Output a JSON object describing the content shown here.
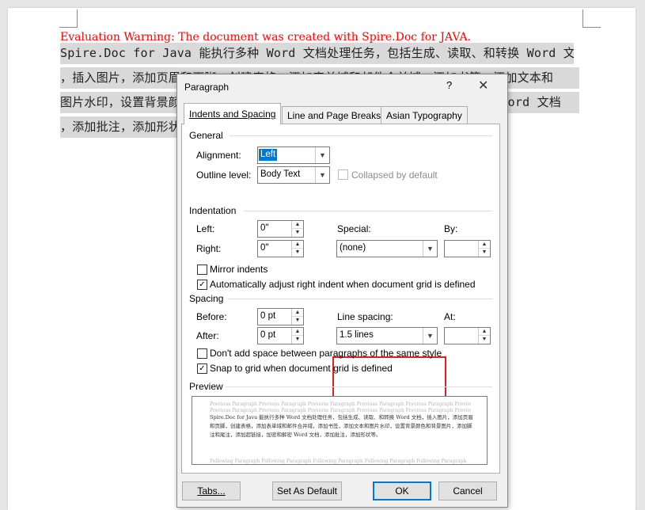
{
  "document": {
    "warning": "Evaluation Warning: The document was created with Spire.Doc for JAVA.",
    "lines": [
      "Spire.Doc for Java 能执行多种 Word 文档处理任务，包括生成、读取、和转换 Word 文档",
      "，插入图片，添加页眉和页脚，创建表格，添加表单域和邮件合并域，添加书签，添加文本和",
      "图片水印，设置背景颜色和背景图片，添加脚注和尾注，添加超链接，加密和解密 Word 文档",
      "，添加批注，添加形状等。"
    ],
    "squiggle_word": "Word"
  },
  "dialog": {
    "title": "Paragraph",
    "help": "?",
    "close": "✕",
    "tabs": [
      {
        "label": "Indents and Spacing",
        "active": true
      },
      {
        "label": "Line and Page Breaks",
        "active": false
      },
      {
        "label": "Asian Typography",
        "active": false
      }
    ],
    "general": {
      "heading": "General",
      "alignment_label": "Alignment:",
      "alignment_value": "Left",
      "outline_label": "Outline level:",
      "outline_value": "Body Text",
      "collapsed_label": "Collapsed by default"
    },
    "indentation": {
      "heading": "Indentation",
      "left_label": "Left:",
      "left_value": "0\"",
      "right_label": "Right:",
      "right_value": "0\"",
      "special_label": "Special:",
      "special_value": "(none)",
      "by_label": "By:",
      "by_value": "",
      "mirror_label": "Mirror indents",
      "auto_adjust_label": "Automatically adjust right indent when document grid is defined"
    },
    "spacing": {
      "heading": "Spacing",
      "before_label": "Before:",
      "before_value": "0 pt",
      "after_label": "After:",
      "after_value": "0 pt",
      "line_spacing_label": "Line spacing:",
      "line_spacing_value": "1.5 lines",
      "at_label": "At:",
      "at_value": "",
      "dont_add_label": "Don't add space between paragraphs of the same style",
      "snap_label": "Snap to grid when document grid is defined"
    },
    "preview": {
      "heading": "Preview",
      "previous_line": "Previous Paragraph Previous Paragraph Previous Paragraph Previous Paragraph Previous Paragraph Previous Paragraph",
      "body": "Spire.Doc for Java 能执行多种 Word 文档处理任务，包括生成、读取、和转换 Word 文档，插入图片，添加页眉和页脚，创建表格，添加表单域和邮件合并域，添加书签，添加文本和图片水印，设置背景颜色和背景图片，添加脚注和尾注，添加超链接，加密和解密 Word 文档，添加批注，添加形状等。",
      "following_line": "Following Paragraph Following Paragraph Following Paragraph Following Paragraph Following Paragraph"
    },
    "buttons": {
      "tabs": "Tabs...",
      "set_default": "Set As Default",
      "ok": "OK",
      "cancel": "Cancel"
    }
  }
}
